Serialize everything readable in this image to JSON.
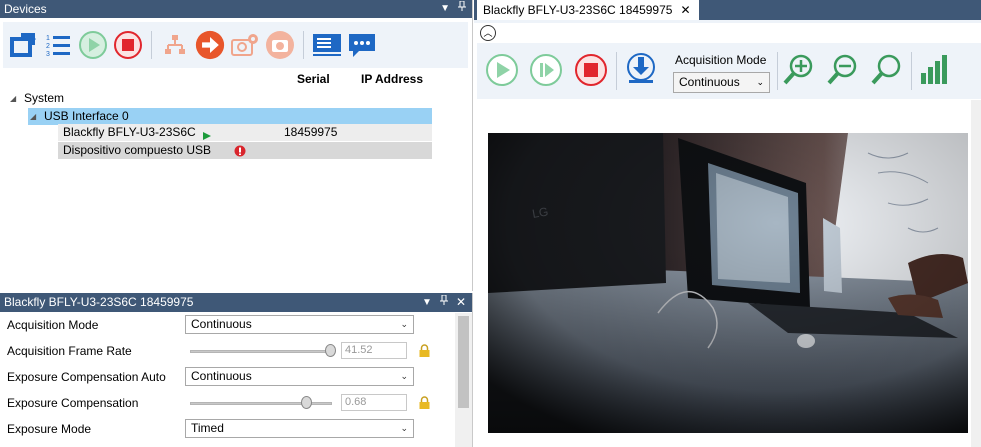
{
  "devices_panel": {
    "title": "Devices",
    "pin_glyph": "▾  ⊥",
    "columns": {
      "serial": "Serial",
      "ip": "IP Address"
    },
    "tree": {
      "root": "System",
      "interface": "USB Interface 0",
      "camera_name": "Blackfly BFLY-U3-23S6C",
      "camera_serial": "18459975",
      "composite": "Dispositivo compuesto USB"
    }
  },
  "properties_panel": {
    "title": "Blackfly BFLY-U3-23S6C 18459975",
    "rows": [
      {
        "label": "Acquisition Mode",
        "value": "Continuous"
      },
      {
        "label": "Acquisition Frame Rate",
        "value": "41.52"
      },
      {
        "label": "Exposure Compensation Auto",
        "value": "Continuous"
      },
      {
        "label": "Exposure Compensation",
        "value": "0.68"
      },
      {
        "label": "Exposure Mode",
        "value": "Timed"
      }
    ]
  },
  "camera_view": {
    "tab_title": "Blackfly BFLY-U3-23S6C 18459975",
    "acquisition_mode_label": "Acquisition Mode",
    "acquisition_mode_value": "Continuous"
  },
  "colors": {
    "title_bar": "#3f5877",
    "selection": "#99d1f4",
    "toolbar_bg": "#eef3f9",
    "play_green": "#3dae6b",
    "stop_red": "#e1262d",
    "icon_blue": "#1e68c4",
    "orange": "#e8562b"
  },
  "icons": [
    "refresh-icon",
    "list-icon",
    "play-icon",
    "stop-icon",
    "network-icon",
    "arrow-right-icon",
    "camera-settings-icon",
    "camera-icon",
    "properties-icon",
    "chat-icon",
    "single-frame-icon",
    "download-icon",
    "zoom-in-icon",
    "zoom-out-icon",
    "zoom-fit-icon",
    "histogram-icon",
    "lock-icon"
  ]
}
